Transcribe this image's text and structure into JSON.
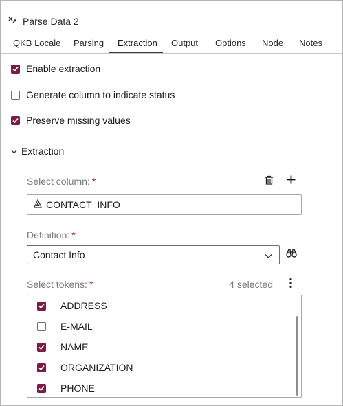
{
  "window": {
    "title": "Parse Data 2",
    "icon": "parse-icon"
  },
  "tabs": [
    {
      "label": "QKB Locale",
      "active": false
    },
    {
      "label": "Parsing",
      "active": false
    },
    {
      "label": "Extraction",
      "active": true
    },
    {
      "label": "Output",
      "active": false
    },
    {
      "label": "Options",
      "active": false
    },
    {
      "label": "Node",
      "active": false
    },
    {
      "label": "Notes",
      "active": false
    }
  ],
  "options": [
    {
      "label": "Enable extraction",
      "checked": true
    },
    {
      "label": "Generate column to indicate status",
      "checked": false
    },
    {
      "label": "Preserve missing values",
      "checked": true
    }
  ],
  "extraction": {
    "section_label": "Extraction",
    "expanded": true,
    "select_column_label": "Select column:",
    "required_marker": "*",
    "column_value": "CONTACT_INFO",
    "definition_label": "Definition:",
    "definition_value": "Contact Info",
    "select_tokens_label": "Select tokens:",
    "selected_count": "4 selected",
    "tokens": [
      {
        "label": "ADDRESS",
        "checked": true
      },
      {
        "label": "E-MAIL",
        "checked": false
      },
      {
        "label": "NAME",
        "checked": true
      },
      {
        "label": "ORGANIZATION",
        "checked": true
      },
      {
        "label": "PHONE",
        "checked": true
      }
    ]
  },
  "colors": {
    "accent": "#7d1a47",
    "required": "#c2185b",
    "label_gray": "#7a7a7a"
  }
}
